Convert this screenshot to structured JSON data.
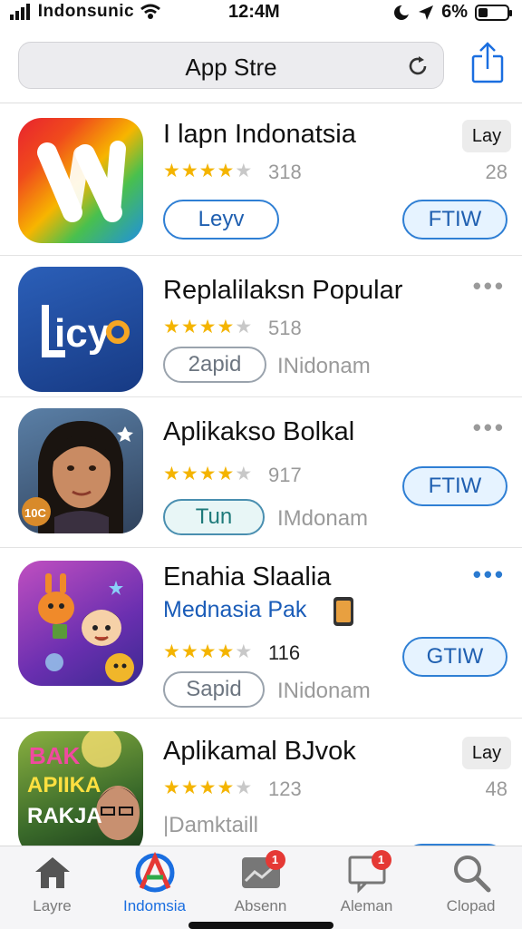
{
  "status_bar": {
    "carrier": "Indonsunic",
    "time": "12:4M",
    "battery": "6%"
  },
  "top_bar": {
    "title": "App Stre"
  },
  "apps": [
    {
      "title": "I lapn Indonatsia",
      "rating_count": "318",
      "stars": 4,
      "left_button": "Leyv",
      "right_button": "FTIW",
      "badge": "Lay",
      "right_number": "28"
    },
    {
      "title": "Replalilaksn Popular",
      "rating_count": "518",
      "stars": 4,
      "left_button": "2apid",
      "side_text": "INidonam"
    },
    {
      "title": "Aplikakso Bolkal",
      "rating_count": "917",
      "stars": 4,
      "left_button": "Tun",
      "side_text": "IMdonam",
      "right_button": "FTIW",
      "icon_badge": "10C"
    },
    {
      "title": "Enahia Slaalia",
      "subtitle": "Mednasia Pak",
      "rating_count": "116",
      "stars": 4.5,
      "left_button": "Sapid",
      "side_text": "INidonam",
      "right_button": "GTIW"
    },
    {
      "title": "Aplikamal BJvok",
      "rating_count": "123",
      "stars": 4,
      "side_text": "|Damktaill",
      "badge": "Lay",
      "right_number": "48",
      "icon_text": [
        "BAK",
        "APIIKA",
        "RAKJA"
      ]
    }
  ],
  "tabs": [
    {
      "label": "Layre",
      "icon": "home-icon",
      "active": false
    },
    {
      "label": "Indomsia",
      "icon": "discover-icon",
      "active": true
    },
    {
      "label": "Absenn",
      "icon": "updates-icon",
      "active": false,
      "badge": "1"
    },
    {
      "label": "Aleman",
      "icon": "message-icon",
      "active": false,
      "badge": "1"
    },
    {
      "label": "Clopad",
      "icon": "search-icon",
      "active": false
    }
  ]
}
